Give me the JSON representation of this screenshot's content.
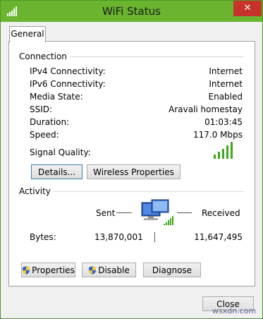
{
  "window": {
    "title": "WiFi Status",
    "close_glyph": "✕"
  },
  "tabs": [
    {
      "label": "General"
    }
  ],
  "connection": {
    "group_label": "Connection",
    "rows": [
      {
        "label": "IPv4 Connectivity:",
        "value": "Internet"
      },
      {
        "label": "IPv6 Connectivity:",
        "value": "Internet"
      },
      {
        "label": "Media State:",
        "value": "Enabled"
      },
      {
        "label": "SSID:",
        "value": "Aravali homestay"
      },
      {
        "label": "Duration:",
        "value": "01:03:45"
      },
      {
        "label": "Speed:",
        "value": "117.0 Mbps"
      }
    ],
    "signal_label": "Signal Quality:",
    "signal_bars_filled": 5,
    "signal_bars_total": 5,
    "details_button": "Details...",
    "wireless_properties_button": "Wireless Properties"
  },
  "activity": {
    "group_label": "Activity",
    "sent_label": "Sent",
    "received_label": "Received",
    "bytes_label": "Bytes:",
    "bytes_sent": "13,870,001",
    "bytes_received": "11,647,495",
    "icon": "network-computer-icon"
  },
  "buttons": {
    "properties": "Properties",
    "disable": "Disable",
    "diagnose": "Diagnose",
    "close": "Close"
  },
  "colors": {
    "titlebar": "#6ab42f",
    "signal": "#3ea81a",
    "close_button": "#c7332b"
  },
  "watermark": "wsxdn.com"
}
